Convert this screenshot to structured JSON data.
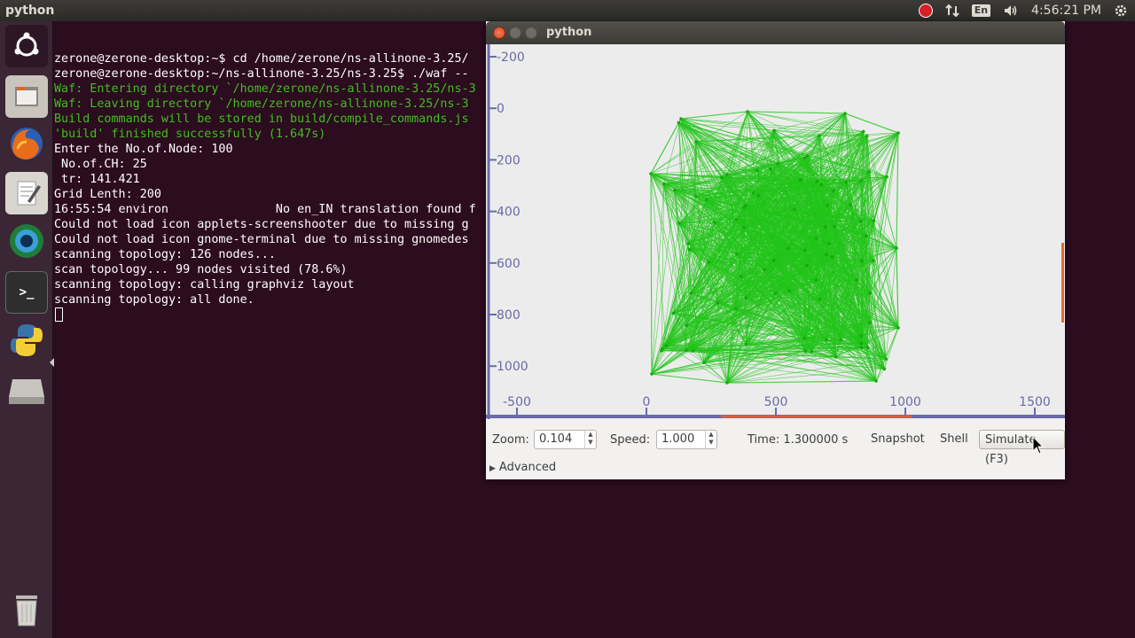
{
  "top_panel": {
    "app_title": "python",
    "keyboard_layout": "En",
    "clock": "4:56:21 PM"
  },
  "launcher": {
    "items": [
      "ubuntu-dash",
      "file-manager",
      "firefox",
      "text-editor",
      "software-center",
      "terminal",
      "python",
      "disk",
      "trash"
    ]
  },
  "terminal": {
    "lines": [
      {
        "text": "zerone@zerone-desktop:~$ cd /home/zerone/ns-allinone-3.25/",
        "color": "white"
      },
      {
        "text": "zerone@zerone-desktop:~/ns-allinone-3.25/ns-3.25$ ./waf --",
        "color": "white"
      },
      {
        "text": "Waf: Entering directory `/home/zerone/ns-allinone-3.25/ns-3",
        "color": "green"
      },
      {
        "text": "Waf: Leaving directory `/home/zerone/ns-allinone-3.25/ns-3",
        "color": "green"
      },
      {
        "text": "Build commands will be stored in build/compile_commands.js",
        "color": "green"
      },
      {
        "text": "'build' finished successfully (1.647s)",
        "color": "green"
      },
      {
        "text": "Enter the No.of.Node: 100",
        "color": "white"
      },
      {
        "text": " No.of.CH: 25",
        "color": "white"
      },
      {
        "text": " tr: 141.421",
        "color": "white"
      },
      {
        "text": "Grid Lenth: 200",
        "color": "white"
      },
      {
        "text": "16:55:54 environ               No en_IN translation found f",
        "color": "white"
      },
      {
        "text": "Could not load icon applets-screenshooter due to missing g",
        "color": "white"
      },
      {
        "text": "Could not load icon gnome-terminal due to missing gnomedes",
        "color": "white"
      },
      {
        "text": "scanning topology: 126 nodes...",
        "color": "white"
      },
      {
        "text": "scan topology... 99 nodes visited (78.6%)",
        "color": "white"
      },
      {
        "text": "scanning topology: calling graphviz layout",
        "color": "white"
      },
      {
        "text": "scanning topology: all done.",
        "color": "white"
      }
    ]
  },
  "python_window": {
    "title": "python",
    "canvas": {
      "y_ticks": [
        "-200",
        "0",
        "200",
        "400",
        "600",
        "800",
        "1000"
      ],
      "x_ticks": [
        "-500",
        "0",
        "500",
        "1000",
        "1500"
      ],
      "link_color": "#22c41a",
      "node_count": 100
    },
    "toolbar": {
      "zoom_label": "Zoom:",
      "zoom_value": "0.104",
      "speed_label": "Speed:",
      "speed_value": "1.000",
      "time_label": "Time: 1.300000 s",
      "snapshot_label": "Snapshot",
      "shell_label": "Shell",
      "simulate_label": "Simulate (F3)"
    },
    "advanced_label": "Advanced"
  },
  "colors": {
    "desktop_bg": "#2c0c1f",
    "terminal_green": "#3fbf1f",
    "axis_color": "#6a6aa8"
  }
}
